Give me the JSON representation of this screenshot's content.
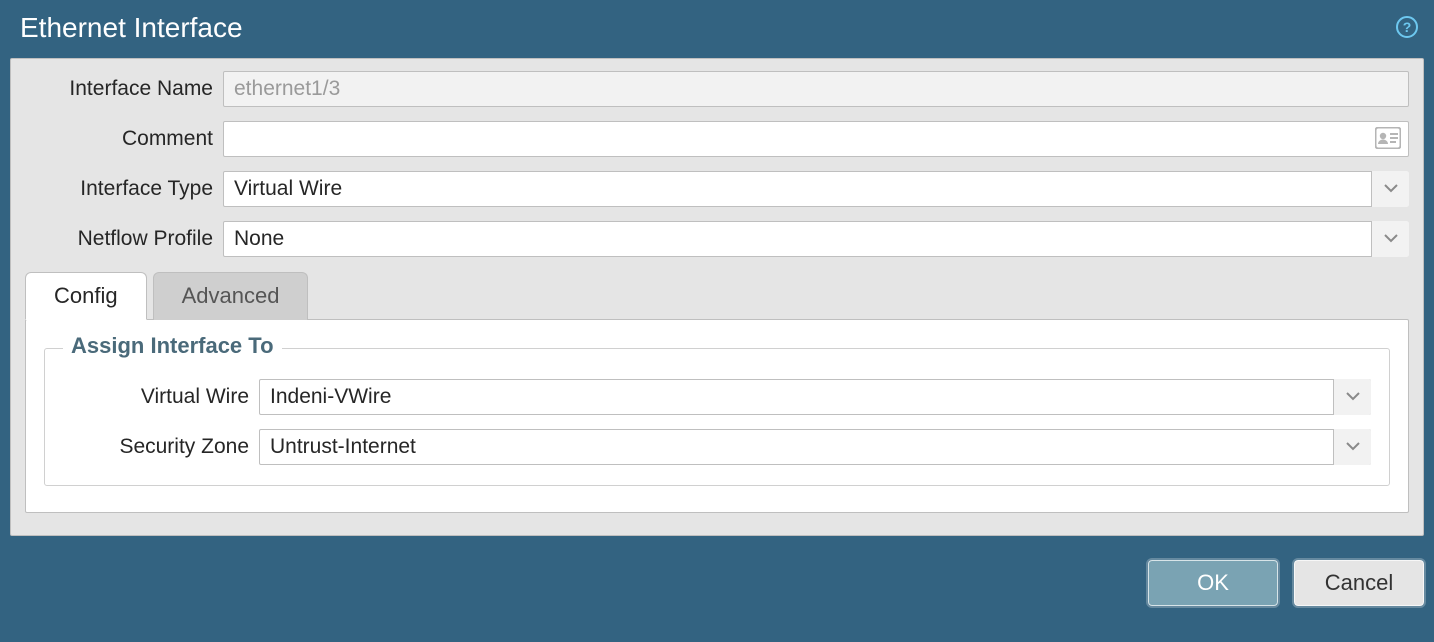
{
  "title": "Ethernet Interface",
  "form": {
    "interface_name": {
      "label": "Interface Name",
      "value": "ethernet1/3"
    },
    "comment": {
      "label": "Comment",
      "value": ""
    },
    "interface_type": {
      "label": "Interface Type",
      "value": "Virtual Wire"
    },
    "netflow_profile": {
      "label": "Netflow Profile",
      "value": "None"
    }
  },
  "tabs": {
    "config": "Config",
    "advanced": "Advanced"
  },
  "fieldset": {
    "legend": "Assign Interface To",
    "virtual_wire": {
      "label": "Virtual Wire",
      "value": "Indeni-VWire"
    },
    "security_zone": {
      "label": "Security Zone",
      "value": "Untrust-Internet"
    }
  },
  "buttons": {
    "ok": "OK",
    "cancel": "Cancel"
  }
}
